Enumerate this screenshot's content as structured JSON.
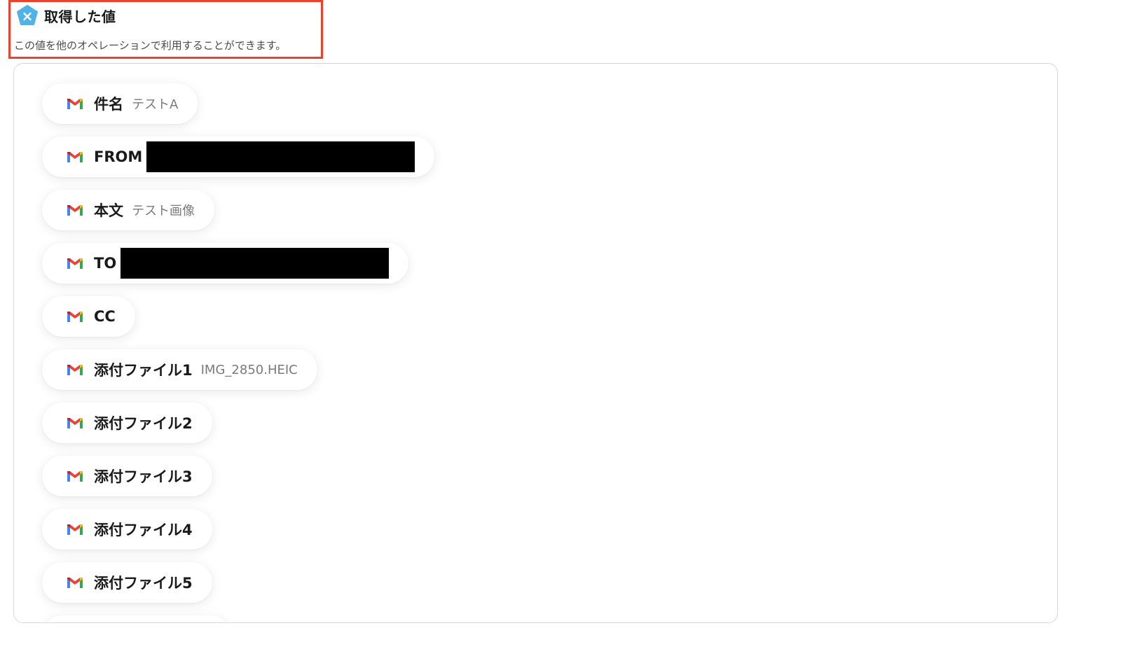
{
  "header": {
    "title": "取得した値",
    "description": "この値を他のオペレーションで利用することができます。"
  },
  "colors": {
    "highlight_border": "#e8442d",
    "yoom_icon": "#4fb3e8"
  },
  "chips": [
    {
      "label": "件名",
      "value": "テストA",
      "redacted": false,
      "icon": "gmail-icon"
    },
    {
      "label": "FROM",
      "value": "",
      "redacted": true,
      "icon": "gmail-icon"
    },
    {
      "label": "本文",
      "value": "テスト画像",
      "redacted": false,
      "icon": "gmail-icon"
    },
    {
      "label": "TO",
      "value": "",
      "redacted": true,
      "icon": "gmail-icon"
    },
    {
      "label": "CC",
      "value": "",
      "redacted": false,
      "icon": "gmail-icon"
    },
    {
      "label": "添付ファイル1",
      "value": "IMG_2850.HEIC",
      "redacted": false,
      "icon": "gmail-icon"
    },
    {
      "label": "添付ファイル2",
      "value": "",
      "redacted": false,
      "icon": "gmail-icon"
    },
    {
      "label": "添付ファイル3",
      "value": "",
      "redacted": false,
      "icon": "gmail-icon"
    },
    {
      "label": "添付ファイル4",
      "value": "",
      "redacted": false,
      "icon": "gmail-icon"
    },
    {
      "label": "添付ファイル5",
      "value": "",
      "redacted": false,
      "icon": "gmail-icon"
    }
  ]
}
